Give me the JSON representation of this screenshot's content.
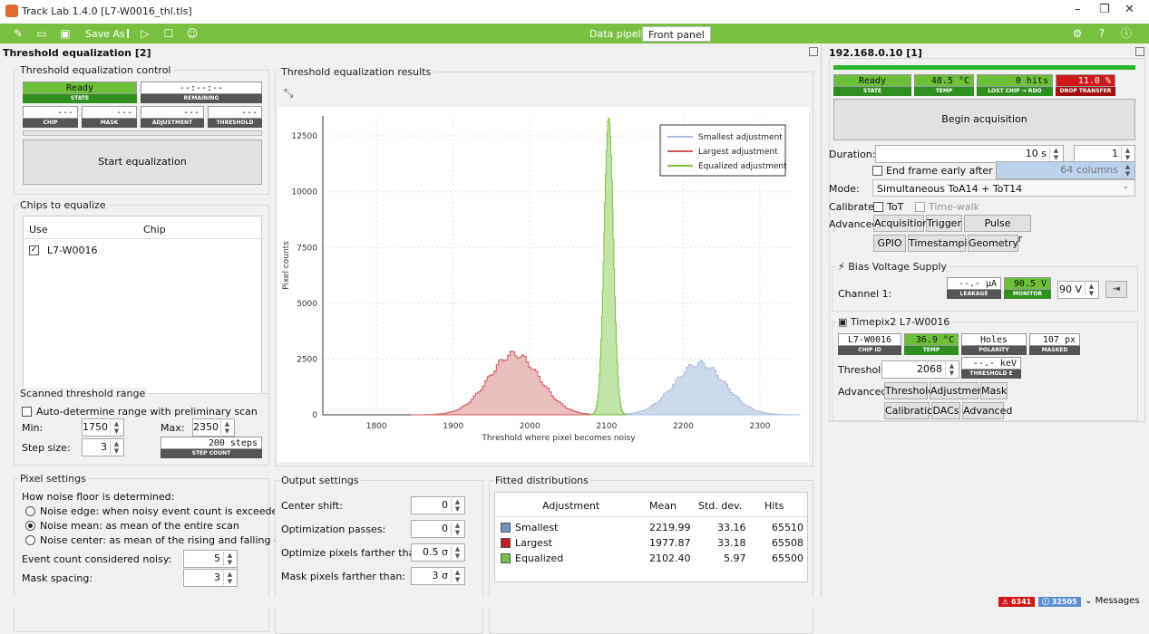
{
  "window": {
    "title": "Track Lab 1.4.0 [L7-W0016_thl.tls]"
  },
  "toolbar": {
    "save_as": "Save As",
    "tabs": [
      "Data pipeline",
      "Front panel"
    ]
  },
  "left_panel": {
    "title": "Threshold equalization [2]",
    "control": {
      "group_title": "Threshold equalization control",
      "state_value": "Ready",
      "state_label": "STATE",
      "remaining_value": "--:--:--",
      "remaining_label": "REMAINING",
      "chip_value": "---",
      "chip_label": "CHIP",
      "mask_value": "---",
      "mask_label": "MASK",
      "adjustment_value": "---",
      "adjustment_label": "ADJUSTMENT",
      "threshold_value": "---",
      "threshold_label": "THRESHOLD",
      "start_button": "Start equalization"
    },
    "chips": {
      "group_title": "Chips to equalize",
      "col_use": "Use",
      "col_chip": "Chip",
      "rows": [
        {
          "chip": "L7-W0016"
        }
      ]
    },
    "range": {
      "group_title": "Scanned threshold range",
      "auto": "Auto-determine range with preliminary scan",
      "min_label": "Min:",
      "min_value": "1750",
      "max_label": "Max:",
      "max_value": "2350",
      "step_label": "Step size:",
      "step_value": "3",
      "step_count_value": "200 steps",
      "step_count_label": "STEP COUNT"
    },
    "pixel": {
      "group_title": "Pixel settings",
      "how": "How noise floor is determined:",
      "opt1": "Noise edge: when noisy event count is exceeded",
      "opt2": "Noise mean: as mean of the entire scan",
      "opt3": "Noise center: as mean of the rising and falling edge",
      "event_label": "Event count considered noisy:",
      "event_value": "5",
      "mask_label": "Mask spacing:",
      "mask_value": "3"
    },
    "results": {
      "group_title": "Threshold equalization results"
    },
    "output": {
      "group_title": "Output settings",
      "center_label": "Center shift:",
      "center_value": "0",
      "passes_label": "Optimization passes:",
      "passes_value": "0",
      "optimize_label": "Optimize pixels farther than:",
      "optimize_value": "0.5 σ",
      "maskpx_label": "Mask pixels farther than:",
      "maskpx_value": "3 σ"
    },
    "fitted": {
      "group_title": "Fitted distributions",
      "headers": [
        "Adjustment",
        "Mean",
        "Std. dev.",
        "Hits"
      ],
      "rows": [
        {
          "name": "Smallest",
          "mean": "2219.99",
          "std": "33.16",
          "hits": "65510",
          "color": "#6f93c4"
        },
        {
          "name": "Largest",
          "mean": "1977.87",
          "std": "33.18",
          "hits": "65508",
          "color": "#c81d1d"
        },
        {
          "name": "Equalized",
          "mean": "2102.40",
          "std": "5.97",
          "hits": "65500",
          "color": "#76c043"
        }
      ]
    }
  },
  "chart_data": {
    "type": "area",
    "xlabel": "Threshold where pixel becomes noisy",
    "ylabel": "Pixel counts",
    "xlim": [
      1730,
      2345
    ],
    "ylim": [
      0,
      13400
    ],
    "xticks": [
      1800,
      1900,
      2000,
      2100,
      2200,
      2300
    ],
    "yticks": [
      0,
      2500,
      5000,
      7500,
      10000,
      12500
    ],
    "series": [
      {
        "name": "Smallest adjustment",
        "color": "#a9bfdc",
        "fill": "#c6d4e8",
        "mean": 2220,
        "std": 33.2,
        "peak": 2300
      },
      {
        "name": "Largest adjustment",
        "color": "#d25a5a",
        "fill": "#e8b3b3",
        "mean": 1978,
        "std": 33.2,
        "peak": 2720
      },
      {
        "name": "Equalized adjustment",
        "color": "#7ac142",
        "fill": "#b8e19a",
        "mean": 2102.4,
        "std": 5.97,
        "peak": 13300
      }
    ]
  },
  "right_panel": {
    "title": "192.168.0.10 [1]",
    "state_value": "Ready",
    "state_label": "STATE",
    "temp_value": "48.5 °C",
    "temp_label": "TEMP",
    "lost_value": "0 hits",
    "lost_label": "LOST CHIP → RDO",
    "drop_value": "11.0 %",
    "drop_label": "DROP TRANSFER",
    "begin_button": "Begin acquisition",
    "duration_label": "Duration:",
    "duration_value": "10 s",
    "frames_value": "1 frames",
    "end_frame": "End frame early after hitting:",
    "columns_value": "64 columns",
    "mode_label": "Mode:",
    "mode_value": "Simultaneous ToA14 + ToT14",
    "calibrate_label": "Calibrate:",
    "tot": "ToT",
    "timewalk": "Time-walk",
    "advanced_label": "Advanced:",
    "adv_buttons": [
      "Acquisition",
      "Trigger",
      "Pulse generator"
    ],
    "adv_buttons2": [
      "GPIO",
      "Timestamping",
      "Geometry"
    ],
    "bias": {
      "title": "Bias Voltage Supply",
      "channel": "Channel 1:",
      "leakage_value": "--.- µA",
      "leakage_label": "LEAKAGE",
      "monitor_value": "90.5 V",
      "monitor_label": "MONITOR",
      "set_value": "90 V"
    },
    "chip": {
      "title": "Timepix2 L7-W0016",
      "id_value": "L7-W0016",
      "id_label": "CHIP ID",
      "temp_value": "36.9 °C",
      "temp_label": "TEMP",
      "pol_value": "Holes",
      "pol_label": "POLARITY",
      "masked_value": "107 px",
      "masked_label": "MASKED",
      "threshold_label": "Threshold:",
      "threshold_value": "2068",
      "thre_value": "--.- keV",
      "thre_label": "THRESHOLD E",
      "advanced_label": "Advanced:",
      "buttons": [
        "Threshold",
        "Adjustment",
        "Mask"
      ],
      "buttons2": [
        "Calibration",
        "DACs",
        "Advanced"
      ]
    }
  },
  "statusbar": {
    "errors": "6341",
    "infos": "32505",
    "messages": "Messages"
  }
}
